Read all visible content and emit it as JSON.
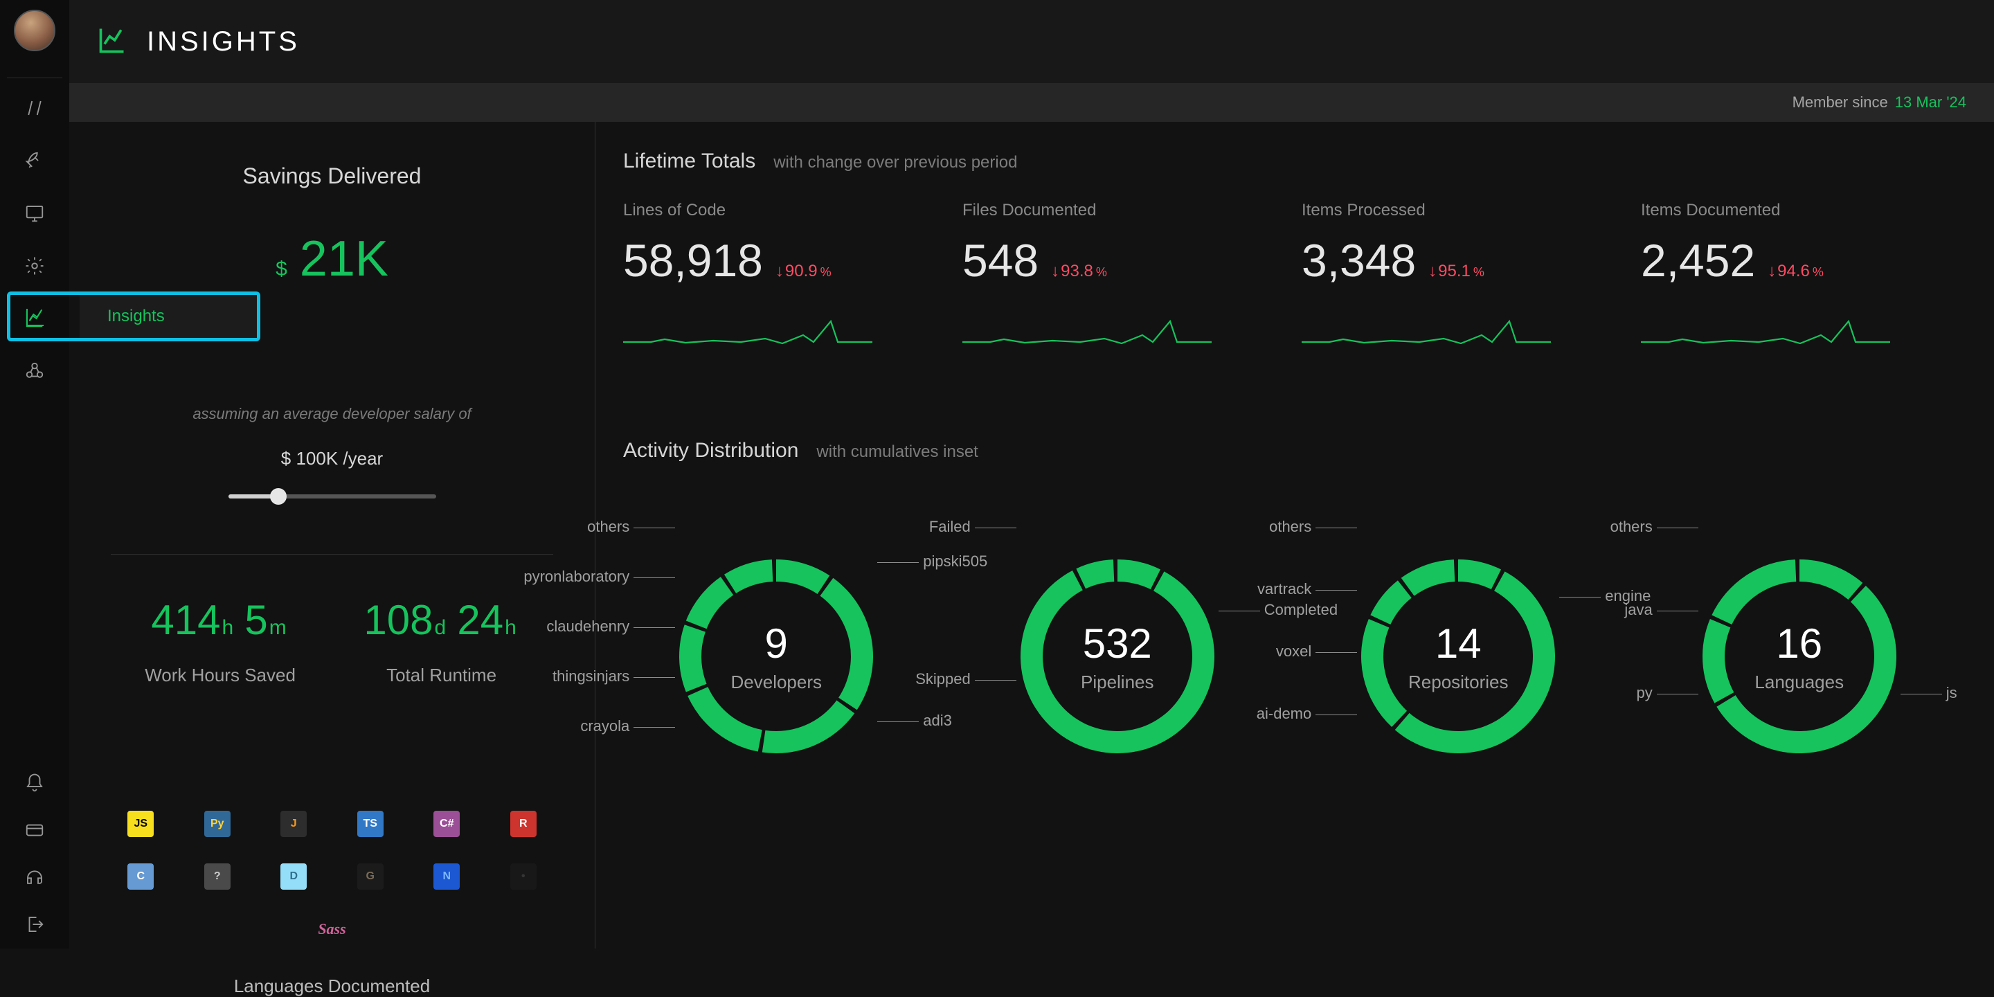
{
  "header": {
    "title": "INSIGHTS"
  },
  "subheader": {
    "member_since_label": "Member since",
    "member_since_date": "13 Mar '24"
  },
  "nav": {
    "active_label": "Insights",
    "items": [
      "slashes",
      "rocket",
      "desktop",
      "gear",
      "chart",
      "webhook"
    ],
    "bottom": [
      "bell",
      "card",
      "headset",
      "logout"
    ]
  },
  "savings": {
    "title": "Savings Delivered",
    "currency": "$",
    "amount": "21K",
    "note": "assuming an average developer salary of",
    "salary": "$ 100K /year",
    "slider_pos_pct": 21
  },
  "stats": {
    "work_hours": {
      "parts": [
        {
          "big": "414",
          "unit": "h"
        },
        {
          "big": "5",
          "unit": "m"
        }
      ],
      "label": "Work Hours Saved"
    },
    "runtime": {
      "parts": [
        {
          "big": "108",
          "unit": "d"
        },
        {
          "big": "24",
          "unit": "h"
        }
      ],
      "label": "Total Runtime"
    }
  },
  "languages": {
    "caption": "Languages Documented",
    "tiles": [
      {
        "bg": "#f7df1e",
        "fg": "#000",
        "txt": "JS"
      },
      {
        "bg": "#306998",
        "fg": "#ffd43b",
        "txt": "Py"
      },
      {
        "bg": "#2d2d2d",
        "fg": "#f89820",
        "txt": "J"
      },
      {
        "bg": "#3178c6",
        "fg": "#fff",
        "txt": "TS"
      },
      {
        "bg": "#9b4f96",
        "fg": "#fff",
        "txt": "C#"
      },
      {
        "bg": "#cc342d",
        "fg": "#fff",
        "txt": "R"
      },
      {
        "bg": "#659ad2",
        "fg": "#fff",
        "txt": "C"
      },
      {
        "bg": "#4a4a4a",
        "fg": "#ccc",
        "txt": "?"
      },
      {
        "bg": "#94def9",
        "fg": "#2e6f8e",
        "txt": "D"
      },
      {
        "bg": "#1b1b1b",
        "fg": "#7a6a58",
        "txt": "G"
      },
      {
        "bg": "#1c58d1",
        "fg": "#7cb8ff",
        "txt": "N"
      },
      {
        "bg": "#181818",
        "fg": "#353535",
        "txt": "•"
      },
      {
        "bg": "transparent",
        "fg": "#cf649a",
        "txt": "Sass",
        "italic": true
      }
    ]
  },
  "lifetime": {
    "title": "Lifetime Totals",
    "subtitle": "with change over previous period",
    "cards": [
      {
        "label": "Lines of Code",
        "value": "58,918",
        "change": "90.9"
      },
      {
        "label": "Files Documented",
        "value": "548",
        "change": "93.8"
      },
      {
        "label": "Items Processed",
        "value": "3,348",
        "change": "95.1"
      },
      {
        "label": "Items Documented",
        "value": "2,452",
        "change": "94.6"
      }
    ]
  },
  "activity": {
    "title": "Activity Distribution",
    "subtitle": "with cumulatives inset",
    "donuts": [
      {
        "center_value": "9",
        "center_label": "Developers",
        "left_labels": [
          "others",
          "pyronlaboratory",
          "claudehenry",
          "thingsinjars",
          "crayola"
        ],
        "right_labels": [
          "pipski505",
          "adi3"
        ]
      },
      {
        "center_value": "532",
        "center_label": "Pipelines",
        "left_labels": [
          "Failed",
          "Skipped"
        ],
        "right_labels": [
          "Completed"
        ]
      },
      {
        "center_value": "14",
        "center_label": "Repositories",
        "left_labels": [
          "others",
          "vartrack",
          "voxel",
          "ai-demo"
        ],
        "right_labels": [
          "engine"
        ]
      },
      {
        "center_value": "16",
        "center_label": "Languages",
        "left_labels": [
          "others",
          "java",
          "py"
        ],
        "right_labels": [
          "js"
        ]
      }
    ]
  },
  "chart_data": {
    "type": "pie",
    "charts": [
      {
        "name": "Developers",
        "total": 9,
        "slices": [
          {
            "label": "others",
            "pct": 10
          },
          {
            "label": "pipski505",
            "pct": 25
          },
          {
            "label": "adi3",
            "pct": 18
          },
          {
            "label": "crayola",
            "pct": 16
          },
          {
            "label": "thingsinjars",
            "pct": 12
          },
          {
            "label": "claudehenry",
            "pct": 10
          },
          {
            "label": "pyronlaboratory",
            "pct": 9
          }
        ]
      },
      {
        "name": "Pipelines",
        "total": 532,
        "slices": [
          {
            "label": "Failed",
            "pct": 8
          },
          {
            "label": "Completed",
            "pct": 85
          },
          {
            "label": "Skipped",
            "pct": 7
          }
        ]
      },
      {
        "name": "Repositories",
        "total": 14,
        "slices": [
          {
            "label": "others",
            "pct": 8
          },
          {
            "label": "engine",
            "pct": 54
          },
          {
            "label": "ai-demo",
            "pct": 20
          },
          {
            "label": "voxel",
            "pct": 8
          },
          {
            "label": "vartrack",
            "pct": 10
          }
        ]
      },
      {
        "name": "Languages",
        "total": 16,
        "slices": [
          {
            "label": "others",
            "pct": 12
          },
          {
            "label": "js",
            "pct": 55
          },
          {
            "label": "py",
            "pct": 15
          },
          {
            "label": "java",
            "pct": 18
          }
        ]
      }
    ],
    "sparklines_note": "four sparklines show mostly flat low activity with a single spike near the right end"
  }
}
